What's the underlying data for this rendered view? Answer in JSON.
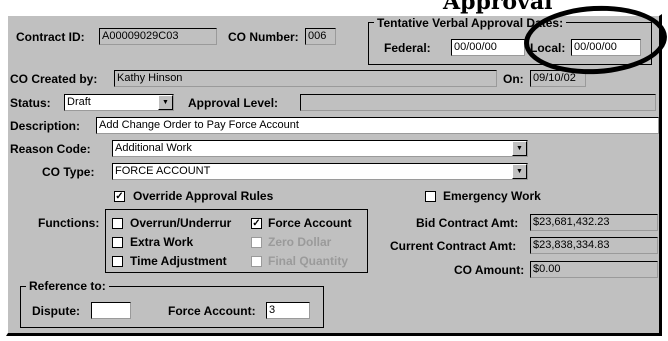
{
  "header_fragment": "Approval",
  "contract": {
    "contract_id_label": "Contract ID:",
    "contract_id_value": "A00009029C03",
    "co_number_label": "CO Number:",
    "co_number_value": "006"
  },
  "tentative": {
    "title": "Tentative Verbal Approval Dates:",
    "federal_label": "Federal:",
    "federal_value": "00/00/00",
    "local_label": "Local:",
    "local_value": "00/00/00"
  },
  "created": {
    "created_by_label": "CO Created by:",
    "created_by_value": "Kathy Hinson",
    "on_label": "On:",
    "on_value": "09/10/02"
  },
  "status": {
    "status_label": "Status:",
    "status_value": "Draft",
    "approval_level_label": "Approval Level:",
    "approval_level_value": ""
  },
  "description": {
    "label": "Description:",
    "value": "Add Change Order to Pay Force Account"
  },
  "reason": {
    "label": "Reason Code:",
    "value": "Additional Work"
  },
  "co_type": {
    "label": "CO Type:",
    "value": "FORCE ACCOUNT"
  },
  "override": {
    "label": "Override Approval Rules",
    "checked": true
  },
  "emergency": {
    "label": "Emergency Work",
    "checked": false
  },
  "functions": {
    "label": "Functions:",
    "items": [
      {
        "label": "Overrun/Underrur",
        "checked": false,
        "disabled": false
      },
      {
        "label": "Force Account",
        "checked": true,
        "disabled": false
      },
      {
        "label": "Extra Work",
        "checked": false,
        "disabled": false
      },
      {
        "label": "Zero Dollar",
        "checked": false,
        "disabled": true
      },
      {
        "label": "Time Adjustment",
        "checked": false,
        "disabled": false
      },
      {
        "label": "Final Quantity",
        "checked": false,
        "disabled": true
      }
    ]
  },
  "amounts": {
    "bid_label": "Bid Contract Amt:",
    "bid_value": "$23,681,432.23",
    "current_label": "Current Contract Amt:",
    "current_value": "$23,838,334.83",
    "co_label": "CO Amount:",
    "co_value": "$0.00"
  },
  "reference": {
    "title": "Reference to:",
    "dispute_label": "Dispute:",
    "dispute_value": "",
    "force_account_label": "Force Account:",
    "force_account_value": "3"
  },
  "icons": {
    "check": "✓",
    "dropdown": "▼"
  }
}
